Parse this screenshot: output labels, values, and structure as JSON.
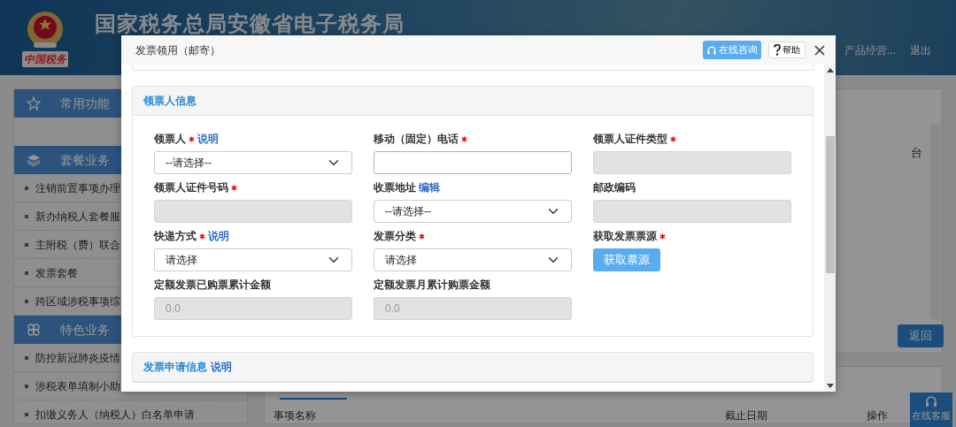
{
  "header": {
    "title": "国家税务总局安徽省电子税务局",
    "emblem_caption": "中国税务",
    "user_text": "产品经营...",
    "logout": "退出"
  },
  "sidebar": {
    "groups": [
      {
        "title": "常用功能",
        "kind": "favorites"
      },
      {
        "title": "套餐业务",
        "kind": "packages",
        "items": [
          "注销前置事项办理",
          "新办纳税人套餐服",
          "主附税（费）联合",
          "发票套餐",
          "跨区域涉税事项综"
        ]
      },
      {
        "title": "特色业务",
        "kind": "featured",
        "items": [
          "防控新冠肺炎疫情",
          "涉税表单填制小助",
          "扣缴义务人（纳税人）白名单申请"
        ]
      }
    ]
  },
  "main": {
    "fragment": "台",
    "back_button": "返回",
    "table": {
      "columns": [
        "事项名称",
        "截止日期",
        "操作"
      ]
    }
  },
  "chat_button": "在线客服",
  "dialog": {
    "title": "发票领用（邮寄）",
    "consult_button": "在线咨询",
    "help_button": "帮助",
    "sections": [
      {
        "title": "领票人信息",
        "fields": [
          {
            "label": "领票人",
            "required": true,
            "link": "说明",
            "kind": "select",
            "value": "--请选择--"
          },
          {
            "label": "移动（固定）电话",
            "required": true,
            "kind": "input",
            "disabled": false
          },
          {
            "label": "领票人证件类型",
            "required": true,
            "kind": "input",
            "disabled": true
          },
          {
            "label": "领票人证件号码",
            "required": true,
            "kind": "input",
            "disabled": true
          },
          {
            "label": "收票地址",
            "required": false,
            "link": "编辑",
            "kind": "select",
            "value": "--请选择--"
          },
          {
            "label": "邮政编码",
            "required": false,
            "kind": "input",
            "disabled": true
          },
          {
            "label": "快递方式",
            "required": true,
            "link": "说明",
            "kind": "select",
            "value": "请选择"
          },
          {
            "label": "发票分类",
            "required": true,
            "kind": "select",
            "value": "请选择"
          },
          {
            "label": "获取发票票源",
            "required": true,
            "kind": "button",
            "value": "获取票源"
          },
          {
            "label": "定额发票已购票累计金额",
            "required": false,
            "kind": "input",
            "disabled": true,
            "value": "0.0"
          },
          {
            "label": "定额发票月累计购票金额",
            "required": false,
            "kind": "input",
            "disabled": true,
            "value": "0.0"
          }
        ]
      },
      {
        "title": "发票申请信息",
        "link": "说明"
      }
    ]
  }
}
